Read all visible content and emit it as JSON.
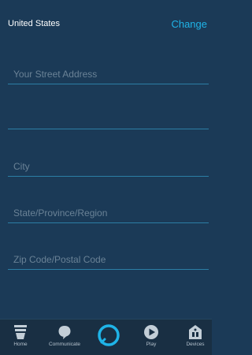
{
  "header": {
    "country": "United States",
    "change_label": "Change"
  },
  "form": {
    "street_placeholder": "Your Street Address",
    "street2_placeholder": "",
    "city_placeholder": "City",
    "state_placeholder": "State/Province/Region",
    "zip_placeholder": "Zip Code/Postal Code"
  },
  "nav": {
    "items": [
      {
        "label": "Home",
        "icon": "home-icon"
      },
      {
        "label": "Communicate",
        "icon": "chat-bubble-icon"
      },
      {
        "label": "",
        "icon": "alexa-ring-icon"
      },
      {
        "label": "Play",
        "icon": "play-icon"
      },
      {
        "label": "Devices",
        "icon": "devices-icon"
      }
    ]
  },
  "colors": {
    "background": "#1b3a57",
    "accent": "#1fb4e8",
    "field_line": "#2c7ea5",
    "nav_bg": "#192f43"
  }
}
